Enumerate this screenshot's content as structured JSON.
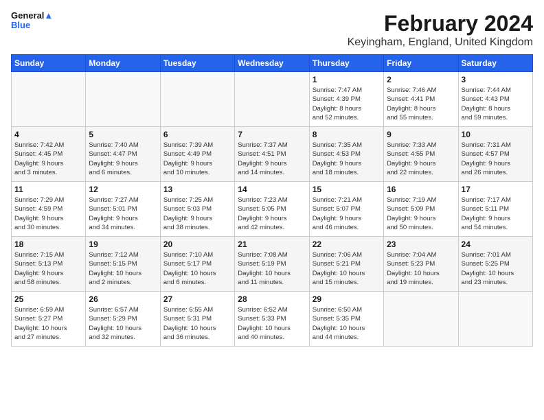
{
  "logo": {
    "line1": "General",
    "line2": "Blue"
  },
  "title": "February 2024",
  "location": "Keyingham, England, United Kingdom",
  "days_header": [
    "Sunday",
    "Monday",
    "Tuesday",
    "Wednesday",
    "Thursday",
    "Friday",
    "Saturday"
  ],
  "weeks": [
    [
      {
        "day": "",
        "info": ""
      },
      {
        "day": "",
        "info": ""
      },
      {
        "day": "",
        "info": ""
      },
      {
        "day": "",
        "info": ""
      },
      {
        "day": "1",
        "info": "Sunrise: 7:47 AM\nSunset: 4:39 PM\nDaylight: 8 hours\nand 52 minutes."
      },
      {
        "day": "2",
        "info": "Sunrise: 7:46 AM\nSunset: 4:41 PM\nDaylight: 8 hours\nand 55 minutes."
      },
      {
        "day": "3",
        "info": "Sunrise: 7:44 AM\nSunset: 4:43 PM\nDaylight: 8 hours\nand 59 minutes."
      }
    ],
    [
      {
        "day": "4",
        "info": "Sunrise: 7:42 AM\nSunset: 4:45 PM\nDaylight: 9 hours\nand 3 minutes."
      },
      {
        "day": "5",
        "info": "Sunrise: 7:40 AM\nSunset: 4:47 PM\nDaylight: 9 hours\nand 6 minutes."
      },
      {
        "day": "6",
        "info": "Sunrise: 7:39 AM\nSunset: 4:49 PM\nDaylight: 9 hours\nand 10 minutes."
      },
      {
        "day": "7",
        "info": "Sunrise: 7:37 AM\nSunset: 4:51 PM\nDaylight: 9 hours\nand 14 minutes."
      },
      {
        "day": "8",
        "info": "Sunrise: 7:35 AM\nSunset: 4:53 PM\nDaylight: 9 hours\nand 18 minutes."
      },
      {
        "day": "9",
        "info": "Sunrise: 7:33 AM\nSunset: 4:55 PM\nDaylight: 9 hours\nand 22 minutes."
      },
      {
        "day": "10",
        "info": "Sunrise: 7:31 AM\nSunset: 4:57 PM\nDaylight: 9 hours\nand 26 minutes."
      }
    ],
    [
      {
        "day": "11",
        "info": "Sunrise: 7:29 AM\nSunset: 4:59 PM\nDaylight: 9 hours\nand 30 minutes."
      },
      {
        "day": "12",
        "info": "Sunrise: 7:27 AM\nSunset: 5:01 PM\nDaylight: 9 hours\nand 34 minutes."
      },
      {
        "day": "13",
        "info": "Sunrise: 7:25 AM\nSunset: 5:03 PM\nDaylight: 9 hours\nand 38 minutes."
      },
      {
        "day": "14",
        "info": "Sunrise: 7:23 AM\nSunset: 5:05 PM\nDaylight: 9 hours\nand 42 minutes."
      },
      {
        "day": "15",
        "info": "Sunrise: 7:21 AM\nSunset: 5:07 PM\nDaylight: 9 hours\nand 46 minutes."
      },
      {
        "day": "16",
        "info": "Sunrise: 7:19 AM\nSunset: 5:09 PM\nDaylight: 9 hours\nand 50 minutes."
      },
      {
        "day": "17",
        "info": "Sunrise: 7:17 AM\nSunset: 5:11 PM\nDaylight: 9 hours\nand 54 minutes."
      }
    ],
    [
      {
        "day": "18",
        "info": "Sunrise: 7:15 AM\nSunset: 5:13 PM\nDaylight: 9 hours\nand 58 minutes."
      },
      {
        "day": "19",
        "info": "Sunrise: 7:12 AM\nSunset: 5:15 PM\nDaylight: 10 hours\nand 2 minutes."
      },
      {
        "day": "20",
        "info": "Sunrise: 7:10 AM\nSunset: 5:17 PM\nDaylight: 10 hours\nand 6 minutes."
      },
      {
        "day": "21",
        "info": "Sunrise: 7:08 AM\nSunset: 5:19 PM\nDaylight: 10 hours\nand 11 minutes."
      },
      {
        "day": "22",
        "info": "Sunrise: 7:06 AM\nSunset: 5:21 PM\nDaylight: 10 hours\nand 15 minutes."
      },
      {
        "day": "23",
        "info": "Sunrise: 7:04 AM\nSunset: 5:23 PM\nDaylight: 10 hours\nand 19 minutes."
      },
      {
        "day": "24",
        "info": "Sunrise: 7:01 AM\nSunset: 5:25 PM\nDaylight: 10 hours\nand 23 minutes."
      }
    ],
    [
      {
        "day": "25",
        "info": "Sunrise: 6:59 AM\nSunset: 5:27 PM\nDaylight: 10 hours\nand 27 minutes."
      },
      {
        "day": "26",
        "info": "Sunrise: 6:57 AM\nSunset: 5:29 PM\nDaylight: 10 hours\nand 32 minutes."
      },
      {
        "day": "27",
        "info": "Sunrise: 6:55 AM\nSunset: 5:31 PM\nDaylight: 10 hours\nand 36 minutes."
      },
      {
        "day": "28",
        "info": "Sunrise: 6:52 AM\nSunset: 5:33 PM\nDaylight: 10 hours\nand 40 minutes."
      },
      {
        "day": "29",
        "info": "Sunrise: 6:50 AM\nSunset: 5:35 PM\nDaylight: 10 hours\nand 44 minutes."
      },
      {
        "day": "",
        "info": ""
      },
      {
        "day": "",
        "info": ""
      }
    ]
  ]
}
